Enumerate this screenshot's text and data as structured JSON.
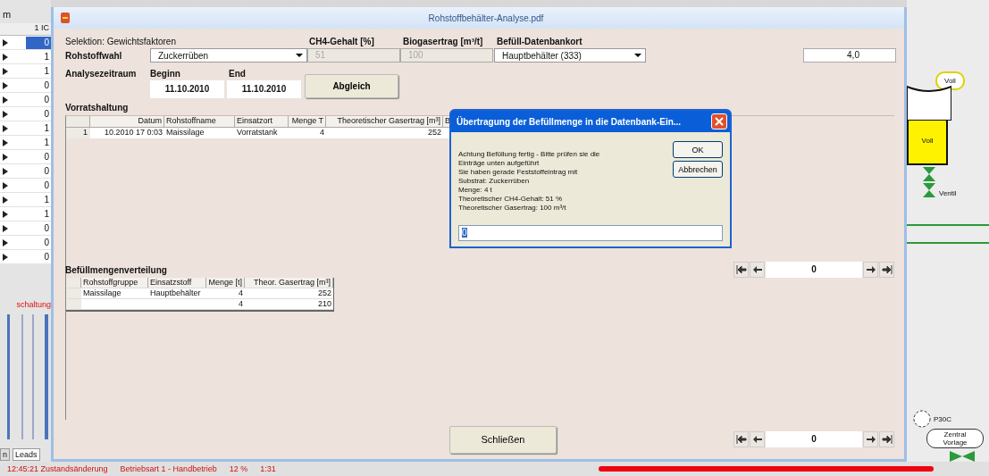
{
  "background": {
    "left_title": "m",
    "grid_header": "1 IC",
    "grid_rows": [
      {
        "value": "0",
        "selected": true
      },
      {
        "value": "1",
        "selected": false
      },
      {
        "value": "1",
        "selected": false
      },
      {
        "value": "0",
        "selected": false
      },
      {
        "value": "0",
        "selected": false
      },
      {
        "value": "0",
        "selected": false
      },
      {
        "value": "1",
        "selected": false
      },
      {
        "value": "1",
        "selected": false
      },
      {
        "value": "0",
        "selected": false
      },
      {
        "value": "0",
        "selected": false
      },
      {
        "value": "0",
        "selected": false
      },
      {
        "value": "1",
        "selected": false
      },
      {
        "value": "1",
        "selected": false
      },
      {
        "value": "0",
        "selected": false
      },
      {
        "value": "0",
        "selected": false
      },
      {
        "value": "0",
        "selected": false
      }
    ],
    "alert": "schaltung",
    "tabs": [
      {
        "label": "n",
        "selected": false
      },
      {
        "label": "Leads",
        "selected": true
      }
    ],
    "status": [
      "12:45:21 Zustandsänderung",
      "Betriebsart 1 - Handbetrieb",
      "12 %",
      "1:31"
    ],
    "diagram": {
      "bubble": "Voll",
      "tank": "Voll",
      "valve": "Ventil",
      "pump": "P30C",
      "vorlage": "Zentral Vorlage"
    }
  },
  "window": {
    "title": "Rohstoffbehälter-Analyse.pdf",
    "selection_label": "Selektion: Gewichtsfaktoren",
    "headers": [
      "CH4-Gehalt [%]",
      "Biogasertrag [m³/t]",
      "Befüll-Datenbankort"
    ],
    "rohstoffwahl": {
      "label": "Rohstoffwahl",
      "value": "Zuckerrüben"
    },
    "ch4": {
      "value": "51",
      "disabled": true
    },
    "ertrag": {
      "value": "100",
      "disabled": true
    },
    "datenbankort": "Hauptbehälter (333)",
    "right_value": "4,0",
    "analyse_label": "Analysezeitraum",
    "begin_label": "Beginn",
    "end_label": "End",
    "begin": "11.10.2010",
    "end": "11.10.2010",
    "abgleich": "Abgleich",
    "vorrat_label": "Vorratshaltung",
    "grid1": {
      "columns": [
        "Datum",
        "Rohstoffname",
        "Einsatzort",
        "Menge T",
        "Theoretischer Gasertrag [m³]",
        "B"
      ],
      "rows": [
        {
          "index": "1",
          "cells": [
            "10.2010 17  0:03",
            "Maissilage",
            "Vorratstank",
            "4",
            "252"
          ]
        }
      ]
    },
    "verteilung_label": "Befüllmengenverteilung",
    "grid2": {
      "columns": [
        "Rohstoffgruppe",
        "Einsatzstoff",
        "Menge [t]",
        "Theor. Gasertrag [m³]"
      ],
      "rows": [
        {
          "gruppe": "Maissilage",
          "stoff": "Hauptbehälter",
          "menge": "4",
          "ertrag": "252"
        },
        {
          "menge": "4",
          "ertrag": "210"
        }
      ]
    },
    "navigators": [
      {
        "value": "0"
      },
      {
        "value": "0"
      }
    ],
    "close": "Schließen"
  },
  "dialog": {
    "title": "Übertragung der Befüllmenge in die Datenbank-Ein...",
    "lines": [
      "Achtung Befüllung fertig - Bitte prüfen sie die",
      "Einträge unten aufgeführt",
      "Sie haben gerade Feststoffeintrag mit",
      "Substrat: Zuckerrüben",
      "Menge: 4 t",
      "Theoretischer CH4-Gehalt: 51 %",
      "Theoretischer Gasertrag: 100 m³/t"
    ],
    "ok": "OK",
    "cancel": "Abbrechen",
    "input": "0"
  }
}
